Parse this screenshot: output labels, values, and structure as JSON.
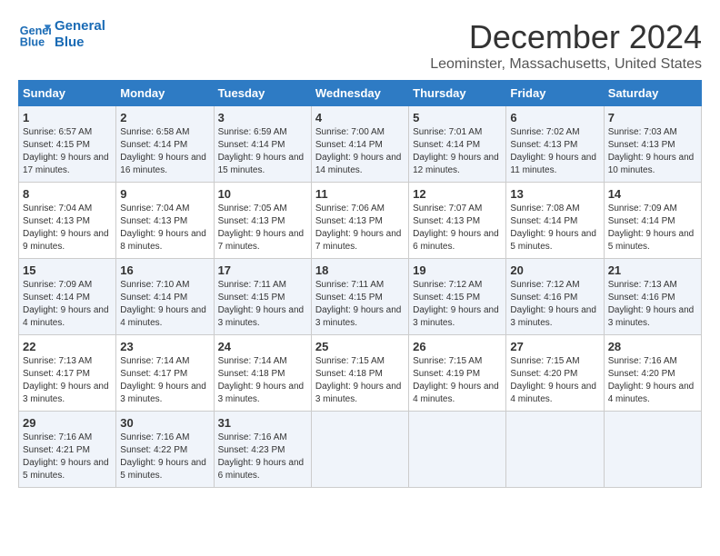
{
  "logo": {
    "line1": "General",
    "line2": "Blue"
  },
  "title": "December 2024",
  "subtitle": "Leominster, Massachusetts, United States",
  "days_of_week": [
    "Sunday",
    "Monday",
    "Tuesday",
    "Wednesday",
    "Thursday",
    "Friday",
    "Saturday"
  ],
  "weeks": [
    [
      {
        "day": "1",
        "sunrise": "6:57 AM",
        "sunset": "4:15 PM",
        "daylight": "9 hours and 17 minutes."
      },
      {
        "day": "2",
        "sunrise": "6:58 AM",
        "sunset": "4:14 PM",
        "daylight": "9 hours and 16 minutes."
      },
      {
        "day": "3",
        "sunrise": "6:59 AM",
        "sunset": "4:14 PM",
        "daylight": "9 hours and 15 minutes."
      },
      {
        "day": "4",
        "sunrise": "7:00 AM",
        "sunset": "4:14 PM",
        "daylight": "9 hours and 14 minutes."
      },
      {
        "day": "5",
        "sunrise": "7:01 AM",
        "sunset": "4:14 PM",
        "daylight": "9 hours and 12 minutes."
      },
      {
        "day": "6",
        "sunrise": "7:02 AM",
        "sunset": "4:13 PM",
        "daylight": "9 hours and 11 minutes."
      },
      {
        "day": "7",
        "sunrise": "7:03 AM",
        "sunset": "4:13 PM",
        "daylight": "9 hours and 10 minutes."
      }
    ],
    [
      {
        "day": "8",
        "sunrise": "7:04 AM",
        "sunset": "4:13 PM",
        "daylight": "9 hours and 9 minutes."
      },
      {
        "day": "9",
        "sunrise": "7:04 AM",
        "sunset": "4:13 PM",
        "daylight": "9 hours and 8 minutes."
      },
      {
        "day": "10",
        "sunrise": "7:05 AM",
        "sunset": "4:13 PM",
        "daylight": "9 hours and 7 minutes."
      },
      {
        "day": "11",
        "sunrise": "7:06 AM",
        "sunset": "4:13 PM",
        "daylight": "9 hours and 7 minutes."
      },
      {
        "day": "12",
        "sunrise": "7:07 AM",
        "sunset": "4:13 PM",
        "daylight": "9 hours and 6 minutes."
      },
      {
        "day": "13",
        "sunrise": "7:08 AM",
        "sunset": "4:14 PM",
        "daylight": "9 hours and 5 minutes."
      },
      {
        "day": "14",
        "sunrise": "7:09 AM",
        "sunset": "4:14 PM",
        "daylight": "9 hours and 5 minutes."
      }
    ],
    [
      {
        "day": "15",
        "sunrise": "7:09 AM",
        "sunset": "4:14 PM",
        "daylight": "9 hours and 4 minutes."
      },
      {
        "day": "16",
        "sunrise": "7:10 AM",
        "sunset": "4:14 PM",
        "daylight": "9 hours and 4 minutes."
      },
      {
        "day": "17",
        "sunrise": "7:11 AM",
        "sunset": "4:15 PM",
        "daylight": "9 hours and 3 minutes."
      },
      {
        "day": "18",
        "sunrise": "7:11 AM",
        "sunset": "4:15 PM",
        "daylight": "9 hours and 3 minutes."
      },
      {
        "day": "19",
        "sunrise": "7:12 AM",
        "sunset": "4:15 PM",
        "daylight": "9 hours and 3 minutes."
      },
      {
        "day": "20",
        "sunrise": "7:12 AM",
        "sunset": "4:16 PM",
        "daylight": "9 hours and 3 minutes."
      },
      {
        "day": "21",
        "sunrise": "7:13 AM",
        "sunset": "4:16 PM",
        "daylight": "9 hours and 3 minutes."
      }
    ],
    [
      {
        "day": "22",
        "sunrise": "7:13 AM",
        "sunset": "4:17 PM",
        "daylight": "9 hours and 3 minutes."
      },
      {
        "day": "23",
        "sunrise": "7:14 AM",
        "sunset": "4:17 PM",
        "daylight": "9 hours and 3 minutes."
      },
      {
        "day": "24",
        "sunrise": "7:14 AM",
        "sunset": "4:18 PM",
        "daylight": "9 hours and 3 minutes."
      },
      {
        "day": "25",
        "sunrise": "7:15 AM",
        "sunset": "4:18 PM",
        "daylight": "9 hours and 3 minutes."
      },
      {
        "day": "26",
        "sunrise": "7:15 AM",
        "sunset": "4:19 PM",
        "daylight": "9 hours and 4 minutes."
      },
      {
        "day": "27",
        "sunrise": "7:15 AM",
        "sunset": "4:20 PM",
        "daylight": "9 hours and 4 minutes."
      },
      {
        "day": "28",
        "sunrise": "7:16 AM",
        "sunset": "4:20 PM",
        "daylight": "9 hours and 4 minutes."
      }
    ],
    [
      {
        "day": "29",
        "sunrise": "7:16 AM",
        "sunset": "4:21 PM",
        "daylight": "9 hours and 5 minutes."
      },
      {
        "day": "30",
        "sunrise": "7:16 AM",
        "sunset": "4:22 PM",
        "daylight": "9 hours and 5 minutes."
      },
      {
        "day": "31",
        "sunrise": "7:16 AM",
        "sunset": "4:23 PM",
        "daylight": "9 hours and 6 minutes."
      },
      {
        "day": "",
        "sunrise": "",
        "sunset": "",
        "daylight": ""
      },
      {
        "day": "",
        "sunrise": "",
        "sunset": "",
        "daylight": ""
      },
      {
        "day": "",
        "sunrise": "",
        "sunset": "",
        "daylight": ""
      },
      {
        "day": "",
        "sunrise": "",
        "sunset": "",
        "daylight": ""
      }
    ]
  ],
  "labels": {
    "sunrise": "Sunrise:",
    "sunset": "Sunset:",
    "daylight": "Daylight:"
  }
}
